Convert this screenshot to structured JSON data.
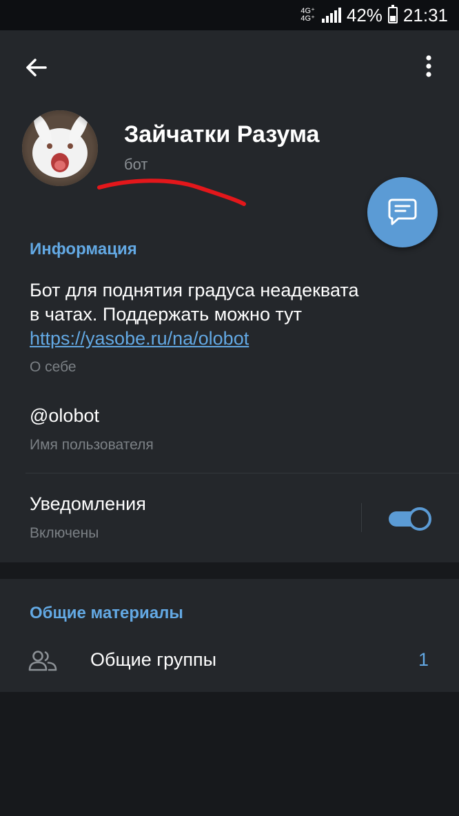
{
  "status_bar": {
    "network_top": "4G⁺",
    "network_bottom": "4G⁺",
    "battery": "42%",
    "time": "21:31",
    "icons": [
      "signal-icon",
      "battery-icon"
    ]
  },
  "header": {
    "back_icon": "arrow-left-icon",
    "menu_icon": "more-vertical-icon",
    "name": "Зайчатки Разума",
    "status": "бот"
  },
  "fab": {
    "icon": "message-icon"
  },
  "info": {
    "title": "Информация",
    "bio_line1": "Бот для поднятия градуса неадеквата",
    "bio_line2": "в чатах. Поддержать можно тут",
    "bio_link": "https://yasobe.ru/na/olobot",
    "bio_caption": "О себе",
    "username": "@olobot",
    "username_caption": "Имя пользователя",
    "notifications_label": "Уведомления",
    "notifications_state": "Включены",
    "notifications_on": true
  },
  "shared": {
    "title": "Общие материалы",
    "groups_label": "Общие группы",
    "groups_count": "1",
    "groups_icon": "groups-icon"
  },
  "colors": {
    "accent": "#63a9e4",
    "fab": "#5b9bd5",
    "panel": "#24272b",
    "background": "#17191c",
    "annotation": "#e3171b"
  }
}
